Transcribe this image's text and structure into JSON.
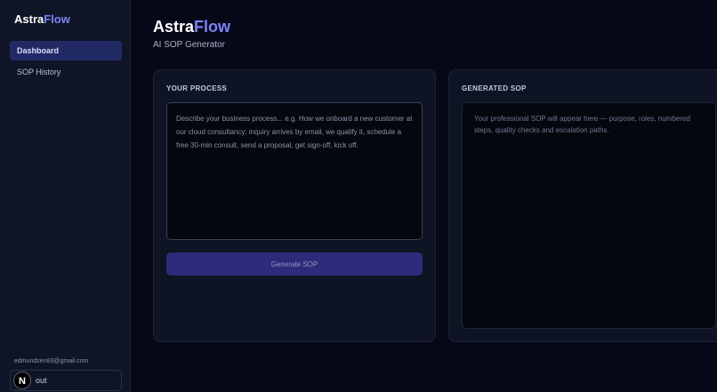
{
  "sidebar": {
    "logo": {
      "part1": "Astra",
      "part2": "Flow"
    },
    "items": [
      {
        "label": "Dashboard",
        "active": true
      },
      {
        "label": "SOP History",
        "active": false
      }
    ],
    "email": "edmundzen83@gmail.com",
    "logout_label": "out",
    "overlay_badge": "N"
  },
  "header": {
    "title_part1": "Astra",
    "title_part2": "Flow",
    "subtitle": "AI SOP Generator"
  },
  "input_panel": {
    "heading": "YOUR PROCESS",
    "placeholder": "Describe your business process... e.g. How we onboard a new customer at our cloud consultancy: inquiry arrives by email, we qualify it, schedule a free 30-min consult, send a proposal, get sign-off, kick off.",
    "value": "",
    "button_label": "Generate SOP"
  },
  "output_panel": {
    "heading": "GENERATED SOP",
    "placeholder_text": "Your professional SOP will appear here — purpose, roles, numbered steps, quality checks and escalation paths."
  },
  "colors": {
    "accent": "#7c83f5",
    "background": "#060818",
    "sidebar": "#0f1526",
    "active_nav": "#222a66",
    "button": "#2d2c7a"
  }
}
